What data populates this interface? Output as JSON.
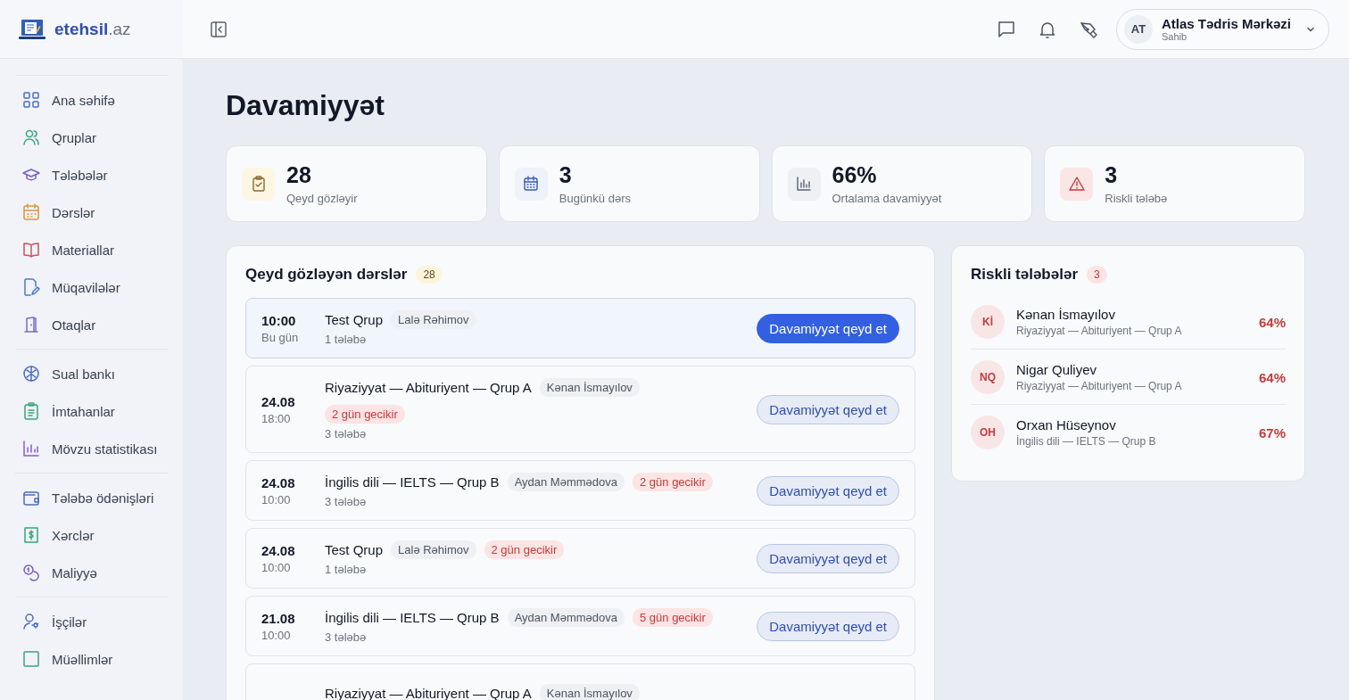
{
  "logo": {
    "name": "etehsil",
    "suffix": ".az"
  },
  "sidebar": {
    "groups": [
      {
        "items": [
          {
            "label": "Ana səhifə"
          },
          {
            "label": "Qruplar"
          },
          {
            "label": "Tələbələr"
          },
          {
            "label": "Dərslər"
          },
          {
            "label": "Materiallar"
          },
          {
            "label": "Müqavilələr"
          },
          {
            "label": "Otaqlar"
          }
        ]
      },
      {
        "items": [
          {
            "label": "Sual bankı"
          },
          {
            "label": "İmtahanlar"
          },
          {
            "label": "Mövzu statistikası"
          }
        ]
      },
      {
        "items": [
          {
            "label": "Tələbə ödənişləri"
          },
          {
            "label": "Xərclər"
          },
          {
            "label": "Maliyyə"
          }
        ]
      },
      {
        "items": [
          {
            "label": "İşçilər"
          },
          {
            "label": "Müəllimlər"
          }
        ]
      }
    ]
  },
  "user": {
    "initials": "AT",
    "name": "Atlas Tədris Mərkəzi",
    "role": "Sahib"
  },
  "page_title": "Davamiyyət",
  "stats": [
    {
      "value": "28",
      "label": "Qeyd gözləyir"
    },
    {
      "value": "3",
      "label": "Bugünkü dərs"
    },
    {
      "value": "66%",
      "label": "Ortalama davamiyyət"
    },
    {
      "value": "3",
      "label": "Riskli tələbə"
    }
  ],
  "pending": {
    "title": "Qeyd gözləyən dərslər",
    "count": "28",
    "lessons": [
      {
        "date": "10:00",
        "time": "Bu gün",
        "title": "Test Qrup",
        "teacher": "Lalə Rəhimov",
        "students": "1 tələbə",
        "button": "Davamiyyət qeyd et",
        "today": true
      },
      {
        "date": "24.08",
        "time": "18:00",
        "title": "Riyaziyyat — Abituriyent — Qrup A",
        "teacher": "Kənan İsmayılov",
        "delay": "2 gün gecikir",
        "students": "3 tələbə",
        "button": "Davamiyyət qeyd et",
        "today": false
      },
      {
        "date": "24.08",
        "time": "10:00",
        "title": "İngilis dili — IELTS — Qrup B",
        "teacher": "Aydan Məmmədova",
        "delay": "2 gün gecikir",
        "students": "3 tələbə",
        "button": "Davamiyyət qeyd et",
        "today": false
      },
      {
        "date": "24.08",
        "time": "10:00",
        "title": "Test Qrup",
        "teacher": "Lalə Rəhimov",
        "delay": "2 gün gecikir",
        "students": "1 tələbə",
        "button": "Davamiyyət qeyd et",
        "today": false
      },
      {
        "date": "21.08",
        "time": "10:00",
        "title": "İngilis dili — IELTS — Qrup B",
        "teacher": "Aydan Məmmədova",
        "delay": "5 gün gecikir",
        "students": "3 tələbə",
        "button": "Davamiyyət qeyd et",
        "today": false
      },
      {
        "title": "Riyaziyyat — Abituriyent — Qrup A",
        "teacher": "Kənan İsmayılov",
        "today": false
      }
    ]
  },
  "risky": {
    "title": "Riskli tələbələr",
    "count": "3",
    "students": [
      {
        "initials": "Kİ",
        "name": "Kənan İsmayılov",
        "group": "Riyaziyyat — Abituriyent — Qrup A",
        "percent": "64%"
      },
      {
        "initials": "NQ",
        "name": "Nigar Quliyev",
        "group": "Riyaziyyat — Abituriyent — Qrup A",
        "percent": "64%"
      },
      {
        "initials": "OH",
        "name": "Orxan Hüseynov",
        "group": "İngilis dili — IELTS — Qrup B",
        "percent": "67%"
      }
    ]
  }
}
